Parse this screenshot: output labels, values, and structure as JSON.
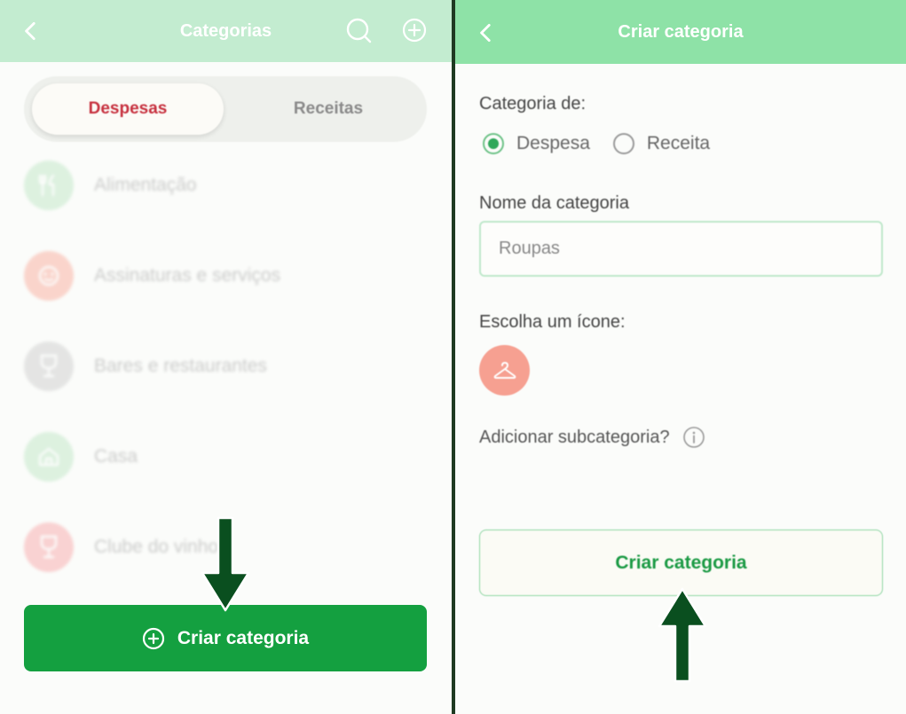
{
  "left": {
    "header": {
      "title": "Categorias"
    },
    "tabs": [
      {
        "label": "Despesas",
        "active": true
      },
      {
        "label": "Receitas",
        "active": false
      }
    ],
    "categories": [
      {
        "label": "Alimentação",
        "icon": "fork-knife-icon",
        "color": "#b9e4c0"
      },
      {
        "label": "Assinaturas e serviços",
        "icon": "face-icon",
        "color": "#f9a594"
      },
      {
        "label": "Bares e restaurantes",
        "icon": "wine-glass-icon",
        "color": "#c9c9c9"
      },
      {
        "label": "Casa",
        "icon": "house-icon",
        "color": "#b9e4c0"
      },
      {
        "label": "Clube do vinho",
        "icon": "wine-glass-icon",
        "color": "#f7a0a2"
      }
    ],
    "create_button": {
      "label": "Criar categoria"
    }
  },
  "right": {
    "header": {
      "title": "Criar categoria"
    },
    "category_type_label": "Categoria de:",
    "type_options": [
      {
        "label": "Despesa",
        "checked": true
      },
      {
        "label": "Receita",
        "checked": false
      }
    ],
    "name_label": "Nome da categoria",
    "name_value": "Roupas",
    "icon_label": "Escolha um ícone:",
    "icon": {
      "name": "hanger-icon",
      "color": "#f6a091"
    },
    "subcategory_label": "Adicionar subcategoria?",
    "create_button": {
      "label": "Criar categoria"
    }
  },
  "colors": {
    "primary_green": "#14a040",
    "header_left": "#c3ecd0",
    "header_right": "#8ee2a7",
    "active_tab_text": "#c7313f",
    "arrow": "#0a4f1f"
  }
}
